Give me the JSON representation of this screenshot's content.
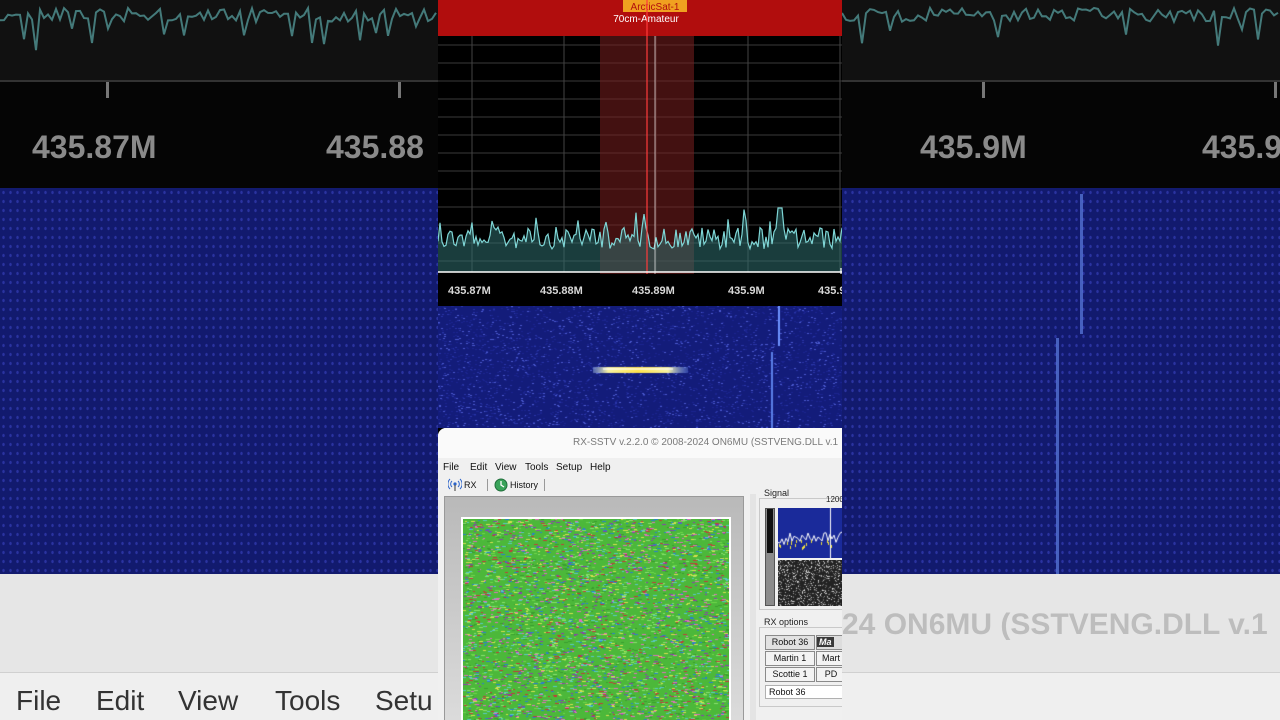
{
  "spectrum": {
    "band_labels": [
      "ArcticSat-1",
      "70cm-Amateur"
    ],
    "freq_ticks": [
      "435.87M",
      "435.88M",
      "435.89M",
      "435.9M",
      "435.9"
    ],
    "colors": {
      "band_bar": "#b10d0d",
      "tag": "#f0a020",
      "trace": "#7fd6d6",
      "marker": "#ff3b3b",
      "waterfall": "#131c7a"
    }
  },
  "background": {
    "freq_ticks": [
      "435.87M",
      "435.88",
      "435.9M",
      "435.9"
    ],
    "window_title": "24 ON6MU (SSTVENG.DLL v.1",
    "menu": [
      "File",
      "Edit",
      "View",
      "Tools",
      "Setu"
    ]
  },
  "rxsstv": {
    "title": "RX-SSTV v.2.2.0 © 2008-2024 ON6MU (SSTVENG.DLL v.1",
    "menu": [
      "File",
      "Edit",
      "View",
      "Tools",
      "Setup",
      "Help"
    ],
    "toolbar": {
      "rx_label": "RX",
      "history_label": "History",
      "rx_icon": "antenna-icon",
      "history_icon": "history-icon"
    },
    "signal": {
      "label": "Signal",
      "freq_mark": "1200"
    },
    "rx_options": {
      "label": "RX options",
      "modes": [
        "Robot 36",
        "Martin 1",
        "Mart",
        "Scottie 1",
        "PD"
      ],
      "logo_text": "Ma",
      "selected_mode": "Robot 36"
    }
  }
}
